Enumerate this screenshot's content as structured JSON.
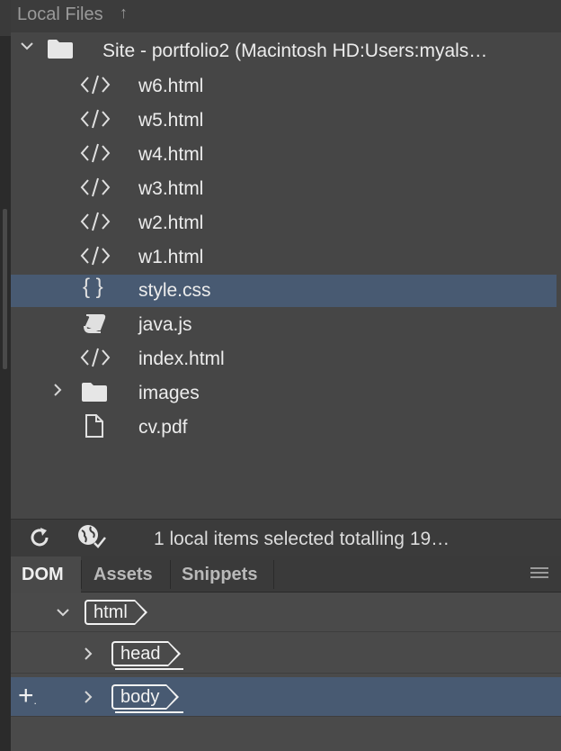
{
  "files_panel": {
    "title": "Local Files",
    "up_icon": "↑",
    "site_root": "Site - portfolio2 (Macintosh HD:Users:myals…",
    "items": [
      {
        "name": "w6.html",
        "icon": "code-file-icon"
      },
      {
        "name": "w5.html",
        "icon": "code-file-icon"
      },
      {
        "name": "w4.html",
        "icon": "code-file-icon"
      },
      {
        "name": "w3.html",
        "icon": "code-file-icon"
      },
      {
        "name": "w2.html",
        "icon": "code-file-icon"
      },
      {
        "name": "w1.html",
        "icon": "code-file-icon"
      },
      {
        "name": "style.css",
        "icon": "css-file-icon",
        "selected": true
      },
      {
        "name": "java.js",
        "icon": "script-file-icon"
      },
      {
        "name": "index.html",
        "icon": "code-file-icon"
      },
      {
        "name": "images",
        "icon": "folder-icon"
      },
      {
        "name": "cv.pdf",
        "icon": "document-file-icon"
      }
    ]
  },
  "status_bar": {
    "text": "1 local items selected totalling 19…"
  },
  "tabs": {
    "dom": "DOM",
    "assets": "Assets",
    "snippets": "Snippets"
  },
  "dom_tree": {
    "html": "html",
    "head": "head",
    "body": "body"
  },
  "colors": {
    "selection": "#485a72",
    "panel_bg": "#464646",
    "header_bg": "#3c3c3c"
  }
}
